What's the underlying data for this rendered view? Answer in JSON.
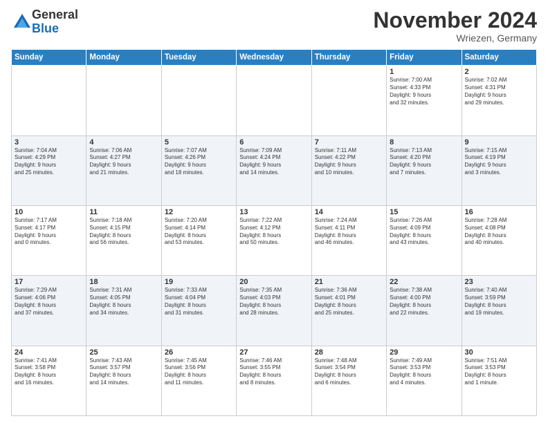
{
  "logo": {
    "general": "General",
    "blue": "Blue"
  },
  "title": "November 2024",
  "location": "Wriezen, Germany",
  "days_header": [
    "Sunday",
    "Monday",
    "Tuesday",
    "Wednesday",
    "Thursday",
    "Friday",
    "Saturday"
  ],
  "weeks": [
    [
      {
        "day": "",
        "info": ""
      },
      {
        "day": "",
        "info": ""
      },
      {
        "day": "",
        "info": ""
      },
      {
        "day": "",
        "info": ""
      },
      {
        "day": "",
        "info": ""
      },
      {
        "day": "1",
        "info": "Sunrise: 7:00 AM\nSunset: 4:33 PM\nDaylight: 9 hours\nand 32 minutes."
      },
      {
        "day": "2",
        "info": "Sunrise: 7:02 AM\nSunset: 4:31 PM\nDaylight: 9 hours\nand 29 minutes."
      }
    ],
    [
      {
        "day": "3",
        "info": "Sunrise: 7:04 AM\nSunset: 4:29 PM\nDaylight: 9 hours\nand 25 minutes."
      },
      {
        "day": "4",
        "info": "Sunrise: 7:06 AM\nSunset: 4:27 PM\nDaylight: 9 hours\nand 21 minutes."
      },
      {
        "day": "5",
        "info": "Sunrise: 7:07 AM\nSunset: 4:26 PM\nDaylight: 9 hours\nand 18 minutes."
      },
      {
        "day": "6",
        "info": "Sunrise: 7:09 AM\nSunset: 4:24 PM\nDaylight: 9 hours\nand 14 minutes."
      },
      {
        "day": "7",
        "info": "Sunrise: 7:11 AM\nSunset: 4:22 PM\nDaylight: 9 hours\nand 10 minutes."
      },
      {
        "day": "8",
        "info": "Sunrise: 7:13 AM\nSunset: 4:20 PM\nDaylight: 9 hours\nand 7 minutes."
      },
      {
        "day": "9",
        "info": "Sunrise: 7:15 AM\nSunset: 4:19 PM\nDaylight: 9 hours\nand 3 minutes."
      }
    ],
    [
      {
        "day": "10",
        "info": "Sunrise: 7:17 AM\nSunset: 4:17 PM\nDaylight: 9 hours\nand 0 minutes."
      },
      {
        "day": "11",
        "info": "Sunrise: 7:18 AM\nSunset: 4:15 PM\nDaylight: 8 hours\nand 56 minutes."
      },
      {
        "day": "12",
        "info": "Sunrise: 7:20 AM\nSunset: 4:14 PM\nDaylight: 8 hours\nand 53 minutes."
      },
      {
        "day": "13",
        "info": "Sunrise: 7:22 AM\nSunset: 4:12 PM\nDaylight: 8 hours\nand 50 minutes."
      },
      {
        "day": "14",
        "info": "Sunrise: 7:24 AM\nSunset: 4:11 PM\nDaylight: 8 hours\nand 46 minutes."
      },
      {
        "day": "15",
        "info": "Sunrise: 7:26 AM\nSunset: 4:09 PM\nDaylight: 8 hours\nand 43 minutes."
      },
      {
        "day": "16",
        "info": "Sunrise: 7:28 AM\nSunset: 4:08 PM\nDaylight: 8 hours\nand 40 minutes."
      }
    ],
    [
      {
        "day": "17",
        "info": "Sunrise: 7:29 AM\nSunset: 4:06 PM\nDaylight: 8 hours\nand 37 minutes."
      },
      {
        "day": "18",
        "info": "Sunrise: 7:31 AM\nSunset: 4:05 PM\nDaylight: 8 hours\nand 34 minutes."
      },
      {
        "day": "19",
        "info": "Sunrise: 7:33 AM\nSunset: 4:04 PM\nDaylight: 8 hours\nand 31 minutes."
      },
      {
        "day": "20",
        "info": "Sunrise: 7:35 AM\nSunset: 4:03 PM\nDaylight: 8 hours\nand 28 minutes."
      },
      {
        "day": "21",
        "info": "Sunrise: 7:36 AM\nSunset: 4:01 PM\nDaylight: 8 hours\nand 25 minutes."
      },
      {
        "day": "22",
        "info": "Sunrise: 7:38 AM\nSunset: 4:00 PM\nDaylight: 8 hours\nand 22 minutes."
      },
      {
        "day": "23",
        "info": "Sunrise: 7:40 AM\nSunset: 3:59 PM\nDaylight: 8 hours\nand 19 minutes."
      }
    ],
    [
      {
        "day": "24",
        "info": "Sunrise: 7:41 AM\nSunset: 3:58 PM\nDaylight: 8 hours\nand 16 minutes."
      },
      {
        "day": "25",
        "info": "Sunrise: 7:43 AM\nSunset: 3:57 PM\nDaylight: 8 hours\nand 14 minutes."
      },
      {
        "day": "26",
        "info": "Sunrise: 7:45 AM\nSunset: 3:56 PM\nDaylight: 8 hours\nand 11 minutes."
      },
      {
        "day": "27",
        "info": "Sunrise: 7:46 AM\nSunset: 3:55 PM\nDaylight: 8 hours\nand 8 minutes."
      },
      {
        "day": "28",
        "info": "Sunrise: 7:48 AM\nSunset: 3:54 PM\nDaylight: 8 hours\nand 6 minutes."
      },
      {
        "day": "29",
        "info": "Sunrise: 7:49 AM\nSunset: 3:53 PM\nDaylight: 8 hours\nand 4 minutes."
      },
      {
        "day": "30",
        "info": "Sunrise: 7:51 AM\nSunset: 3:53 PM\nDaylight: 8 hours\nand 1 minute."
      }
    ]
  ]
}
